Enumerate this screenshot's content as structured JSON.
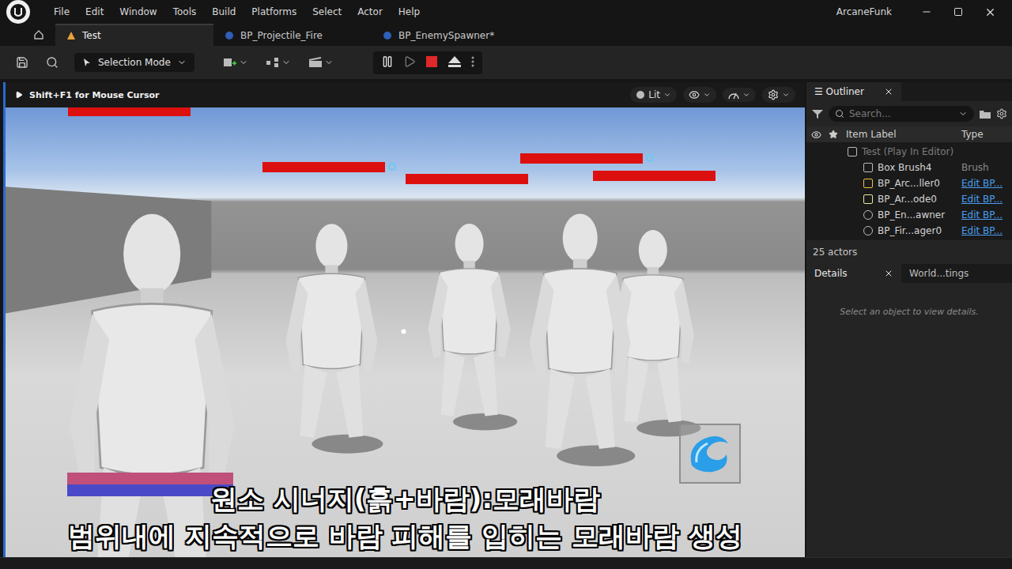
{
  "menu": [
    "File",
    "Edit",
    "Window",
    "Tools",
    "Build",
    "Platforms",
    "Select",
    "Actor",
    "Help"
  ],
  "project": "ArcaneFunk",
  "tabs": [
    {
      "label": "Test",
      "selected": true
    },
    {
      "label": "BP_Projectile_Fire",
      "selected": false
    },
    {
      "label": "BP_EnemySpawner*",
      "selected": false
    }
  ],
  "toolbar": {
    "mode": "Selection Mode",
    "playing": true
  },
  "viewport": {
    "hint": "Shift+F1 for Mouse Cursor",
    "view_mode": "Lit"
  },
  "game": {
    "enemy_bars": [
      {
        "level": 1,
        "effect": false
      },
      {
        "level": 1,
        "effect": true
      },
      {
        "level": 1,
        "effect": false
      },
      {
        "level": 1,
        "effect": true
      },
      {
        "level": 1,
        "effect": false
      }
    ],
    "player": {
      "hp": 1,
      "mp": 1
    },
    "subtitles": [
      "원소 시너지(흙+바람):모래바람",
      "범위내에 지속적으로 바람 피해를 입히는 모래바람 생성"
    ]
  },
  "outliner": {
    "title": "Outliner",
    "search_placeholder": "Search...",
    "columns": [
      "Item Label",
      "Type"
    ],
    "rows": [
      {
        "label": "Test (Play In Editor)",
        "type": "",
        "kind": "world",
        "link": false
      },
      {
        "label": "Box Brush4",
        "type": "Brush",
        "kind": "brush",
        "link": false
      },
      {
        "label": "BP_Arc...ller0",
        "type": "Edit BP...",
        "kind": "controller",
        "link": true
      },
      {
        "label": "BP_Ar...ode0",
        "type": "Edit BP...",
        "kind": "gamemode",
        "link": true
      },
      {
        "label": "BP_En...awner",
        "type": "Edit BP...",
        "kind": "actor",
        "link": true
      },
      {
        "label": "BP_Fir...ager0",
        "type": "Edit BP...",
        "kind": "actor",
        "link": true
      }
    ],
    "count": "25 actors"
  },
  "details": {
    "tabs": [
      {
        "label": "Details",
        "selected": true
      },
      {
        "label": "World...tings",
        "selected": false
      }
    ],
    "empty": "Select an object to view details."
  }
}
